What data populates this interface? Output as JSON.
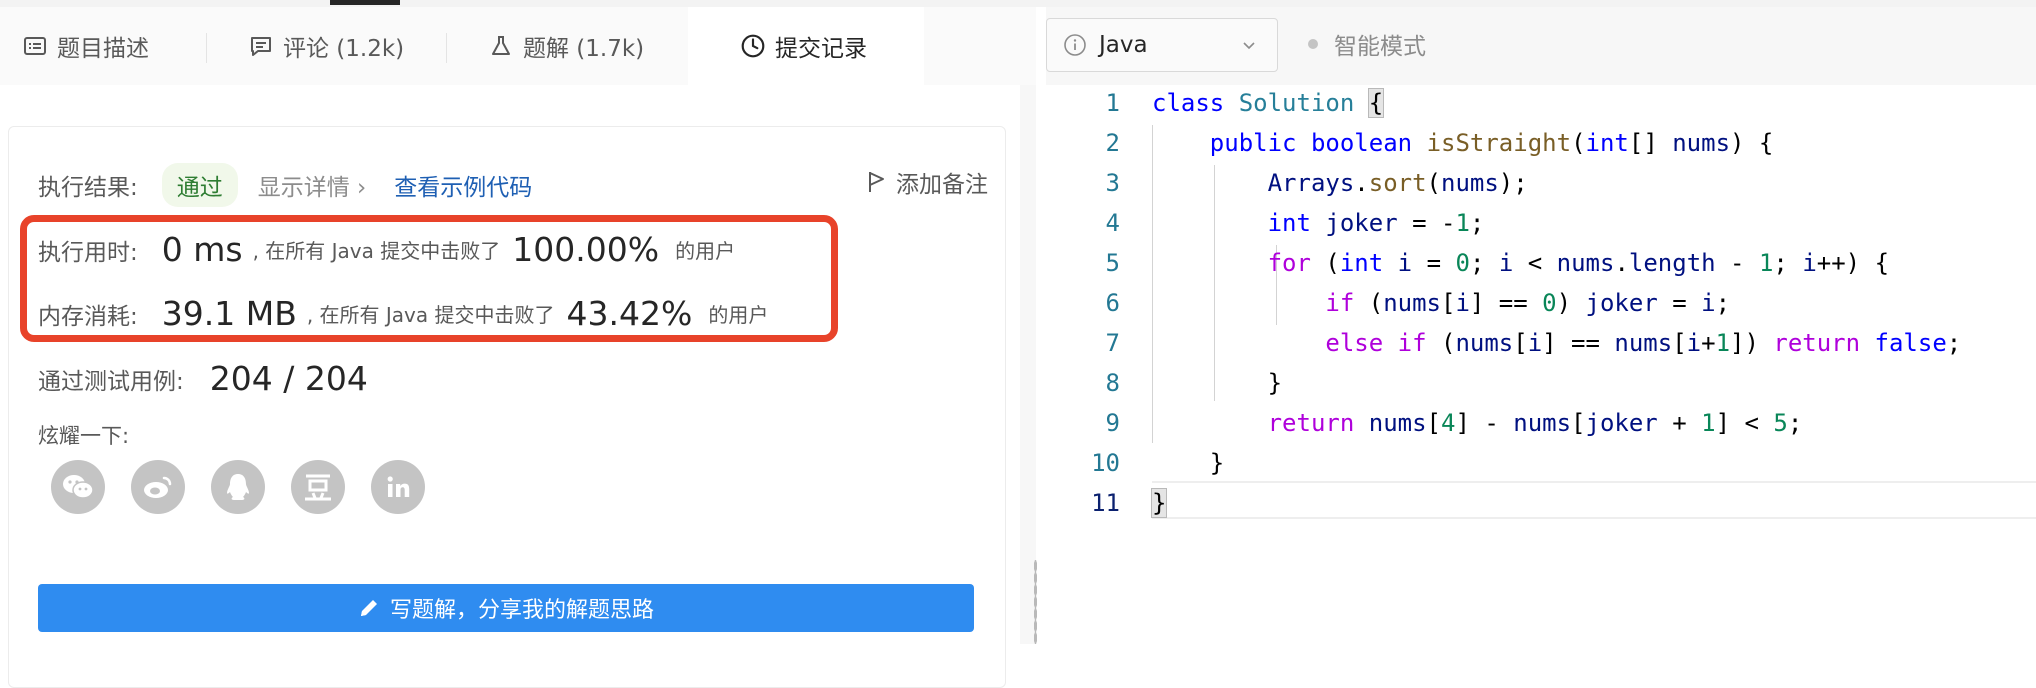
{
  "tabs": [
    {
      "label": "题目描述",
      "icon": "description-icon"
    },
    {
      "label": "评论 (1.2k)",
      "icon": "comment-icon"
    },
    {
      "label": "题解 (1.7k)",
      "icon": "flask-icon"
    },
    {
      "label": "提交记录",
      "icon": "clock-icon",
      "active": true
    }
  ],
  "result": {
    "label": "执行结果:",
    "status": "通过",
    "detail_link": "显示详情 ›",
    "example_link": "查看示例代码",
    "add_note": "添加备注"
  },
  "runtime": {
    "label": "执行用时:",
    "value": "0 ms",
    "text": ", 在所有 Java 提交中击败了",
    "percent": "100.00%",
    "suffix": "的用户"
  },
  "memory": {
    "label": "内存消耗:",
    "value": "39.1 MB",
    "text": ", 在所有 Java 提交中击败了",
    "percent": "43.42%",
    "suffix": "的用户"
  },
  "tests": {
    "label": "通过测试用例:",
    "value": "204 / 204"
  },
  "share": {
    "title": "炫耀一下:",
    "icons": [
      "wechat-icon",
      "weibo-icon",
      "qq-icon",
      "douban-icon",
      "linkedin-icon"
    ]
  },
  "write_button": "写题解，分享我的解题思路",
  "editor": {
    "language": "Java",
    "smart_mode": "智能模式",
    "line_numbers": [
      "1",
      "2",
      "3",
      "4",
      "5",
      "6",
      "7",
      "8",
      "9",
      "10",
      "11"
    ]
  },
  "colors": {
    "highlight_border": "#e8432a",
    "primary_button": "#2f8cf0",
    "link": "#1e5fb3",
    "success": "#2e7d32"
  }
}
